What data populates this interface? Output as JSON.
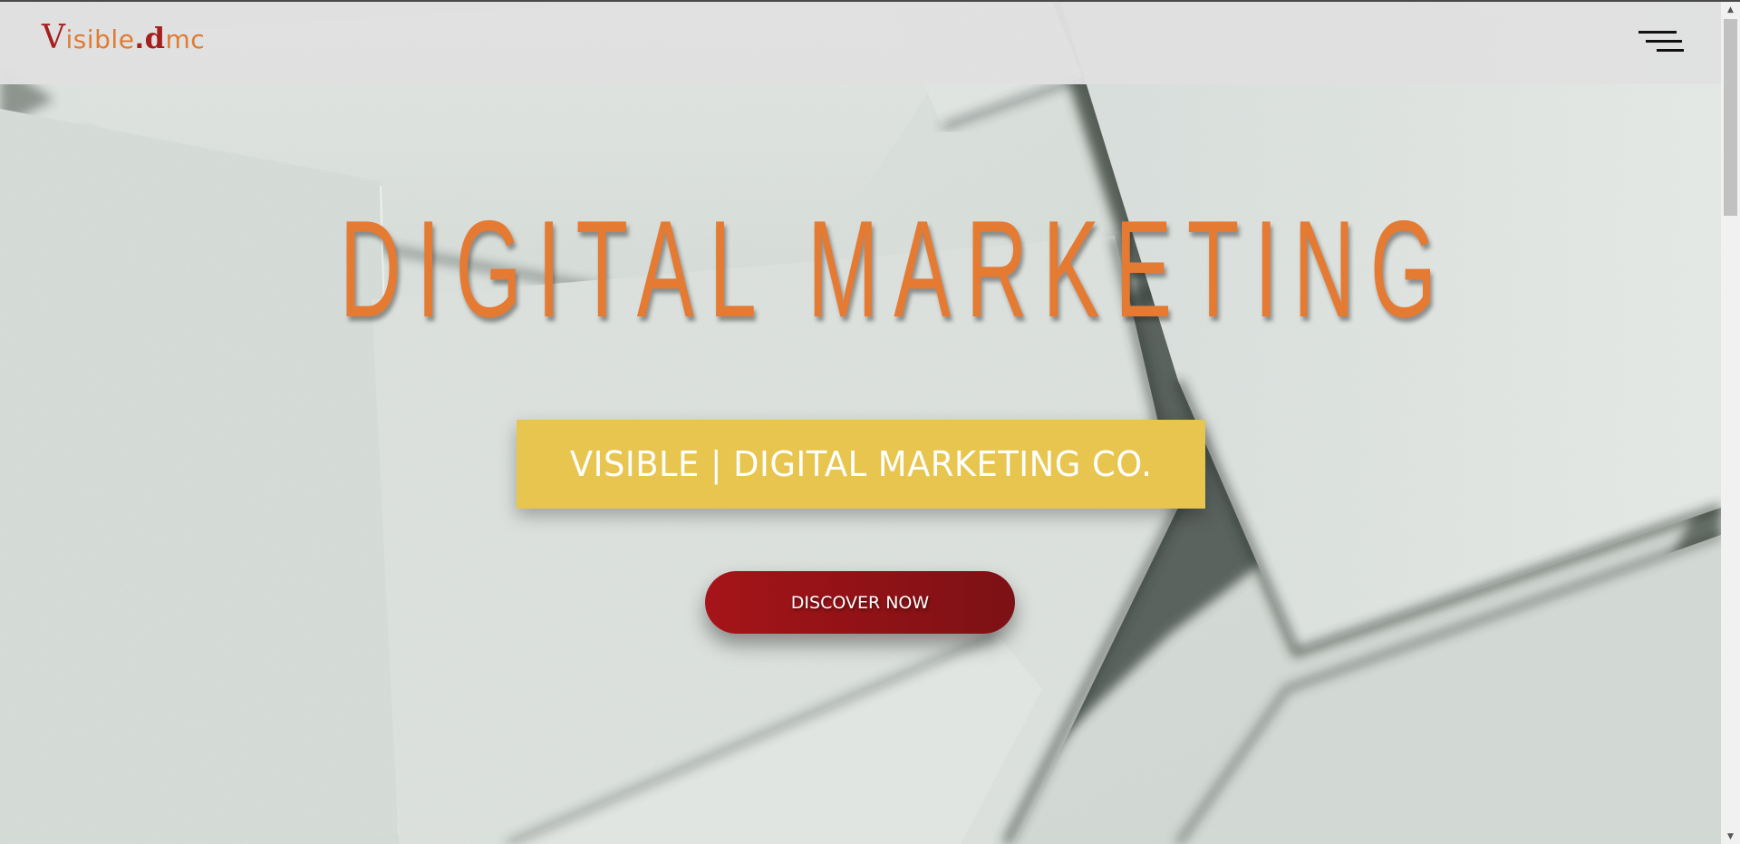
{
  "header": {
    "logo": {
      "part1_big": "V",
      "part1_rest": "isible",
      "dot": ".",
      "part2_big": "d",
      "part2_rest": "mc"
    },
    "menu_icon": "hamburger-menu-icon"
  },
  "hero": {
    "headline": "DIGITAL MARKETING",
    "tagline": "VISIBLE | DIGITAL MARKETING CO.",
    "cta_label": "DISCOVER NOW",
    "background": "layered-paper-sheets"
  },
  "colors": {
    "headline": "#e57a33",
    "tagline_bg": "#e8c54f",
    "cta_bg": "#a51418",
    "logo_accent": "#a51f1f",
    "logo_text": "#e07b33",
    "header_bg": "#e0e0e0"
  },
  "scrollbar": {
    "up_arrow": "▲",
    "down_arrow": "▼"
  }
}
